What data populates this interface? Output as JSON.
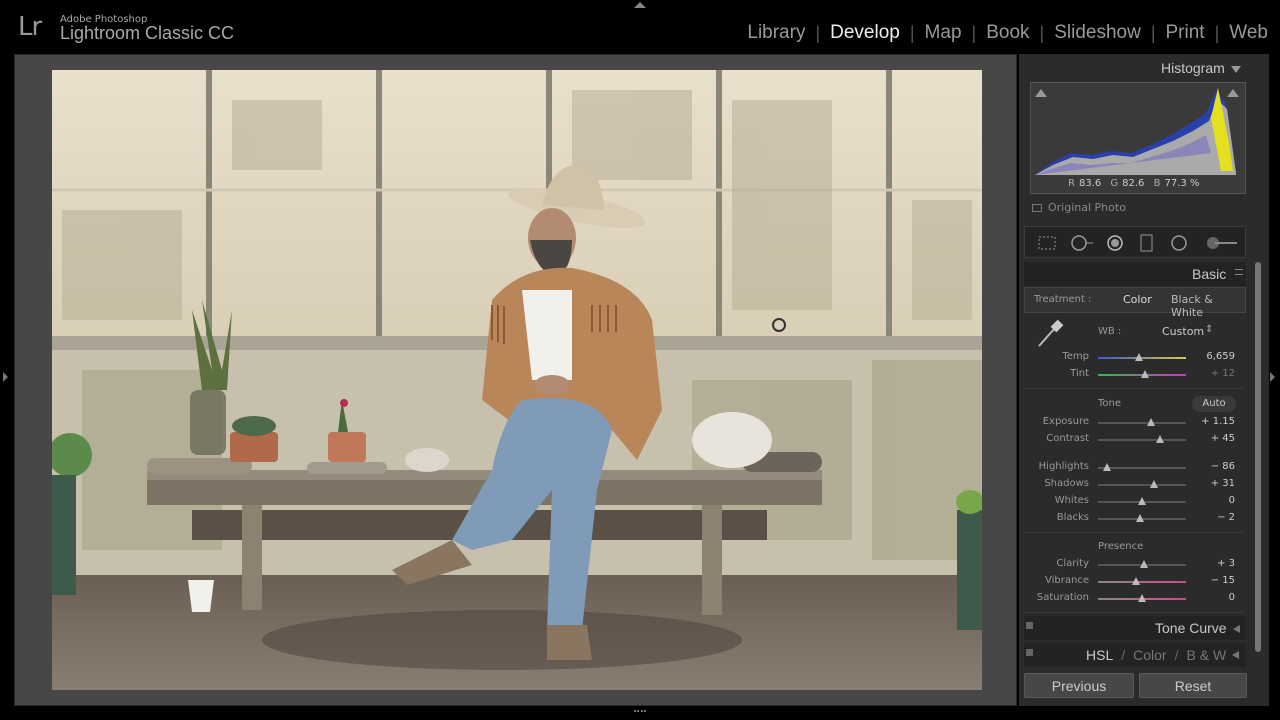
{
  "app": {
    "brand_small": "Adobe Photoshop",
    "brand_name": "Lightroom Classic CC",
    "logo": "Lr"
  },
  "modules": [
    {
      "label": "Library",
      "active": false
    },
    {
      "label": "Develop",
      "active": true
    },
    {
      "label": "Map",
      "active": false
    },
    {
      "label": "Book",
      "active": false
    },
    {
      "label": "Slideshow",
      "active": false
    },
    {
      "label": "Print",
      "active": false
    },
    {
      "label": "Web",
      "active": false
    }
  ],
  "histogram": {
    "title": "Histogram",
    "r_label": "R",
    "r_value": "83.6",
    "g_label": "G",
    "g_value": "82.6",
    "b_label": "B",
    "b_value": "77.3 %",
    "original_photo": "Original Photo"
  },
  "basic": {
    "title": "Basic",
    "treatment_label": "Treatment :",
    "treatment_color": "Color",
    "treatment_bw": "Black & White",
    "wb_label": "WB :",
    "wb_value": "Custom",
    "tone_label": "Tone",
    "auto_label": "Auto",
    "presence_label": "Presence",
    "sliders": [
      {
        "key": "temp",
        "label": "Temp",
        "value": "6,659",
        "pos": 0.47
      },
      {
        "key": "tint",
        "label": "Tint",
        "value": "+ 12",
        "pos": 0.53
      },
      {
        "key": "exposure",
        "label": "Exposure",
        "value": "+ 1.15",
        "pos": 0.6
      },
      {
        "key": "contrast",
        "label": "Contrast",
        "value": "+ 45",
        "pos": 0.7
      },
      {
        "key": "highlights",
        "label": "Highlights",
        "value": "− 86",
        "pos": 0.1
      },
      {
        "key": "shadows",
        "label": "Shadows",
        "value": "+ 31",
        "pos": 0.64
      },
      {
        "key": "whites",
        "label": "Whites",
        "value": "0",
        "pos": 0.5
      },
      {
        "key": "blacks",
        "label": "Blacks",
        "value": "− 2",
        "pos": 0.48
      },
      {
        "key": "clarity",
        "label": "Clarity",
        "value": "+ 3",
        "pos": 0.52
      },
      {
        "key": "vibrance",
        "label": "Vibrance",
        "value": "− 15",
        "pos": 0.43
      },
      {
        "key": "saturation",
        "label": "Saturation",
        "value": "0",
        "pos": 0.5
      }
    ]
  },
  "tone_curve": {
    "title": "Tone Curve"
  },
  "hsl": {
    "hsl": "HSL",
    "color": "Color",
    "bw": "B & W"
  },
  "buttons": {
    "previous": "Previous",
    "reset": "Reset"
  },
  "colors": {
    "accent": "#eeeeee",
    "panel_bg": "#2b2b2b",
    "frame_bg": "#474747"
  }
}
